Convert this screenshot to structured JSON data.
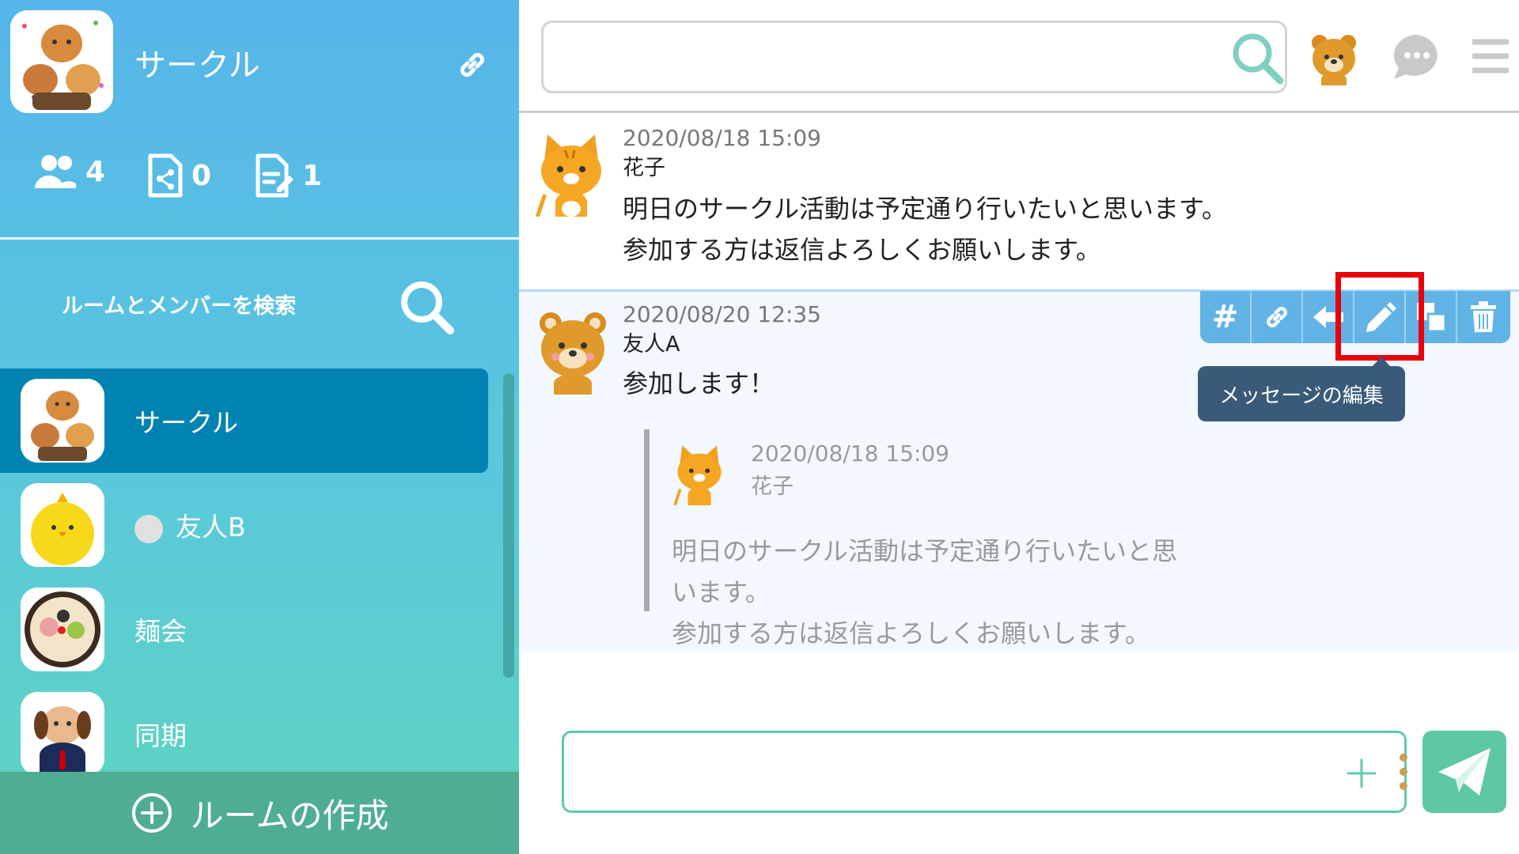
{
  "sidebar": {
    "room_title": "サークル",
    "stats": {
      "members": "4",
      "files": "0",
      "notes": "1"
    },
    "search_label": "ルームとメンバーを検索",
    "rooms": [
      {
        "name": "サークル",
        "active": true
      },
      {
        "name": "友人B",
        "active": false
      },
      {
        "name": "麺会",
        "active": false
      },
      {
        "name": "同期",
        "active": false
      }
    ],
    "create_room_label": "ルームの作成"
  },
  "topbar": {
    "search_value": ""
  },
  "messages": [
    {
      "time": "2020/08/18 15:09",
      "author": "花子",
      "lines": [
        "明日のサークル活動は予定通り行いたいと思います。",
        "参加する方は返信よろしくお願いします。"
      ]
    },
    {
      "time": "2020/08/20 12:35",
      "author": "友人A",
      "lines": [
        "参加します！"
      ],
      "quote": {
        "time": "2020/08/18 15:09",
        "author": "花子",
        "lines": [
          "明日のサークル活動は予定通り行いたいと思います。",
          "参加する方は返信よろしくお願いします。"
        ]
      }
    }
  ],
  "toolbar": {
    "hash_label": "#",
    "tooltip": "メッセージの編集",
    "icons": [
      "hash-icon",
      "link-icon",
      "reply-icon",
      "pencil-icon",
      "copy-icon",
      "trash-icon"
    ]
  },
  "composer": {
    "value": ""
  },
  "colors": {
    "sidebar_top": "#56b5ea",
    "sidebar_bottom": "#5ed5bf",
    "active_room": "#0083b3",
    "toolbar": "#61b3e6",
    "highlight": "#e8000a",
    "send": "#5ec7a6"
  }
}
